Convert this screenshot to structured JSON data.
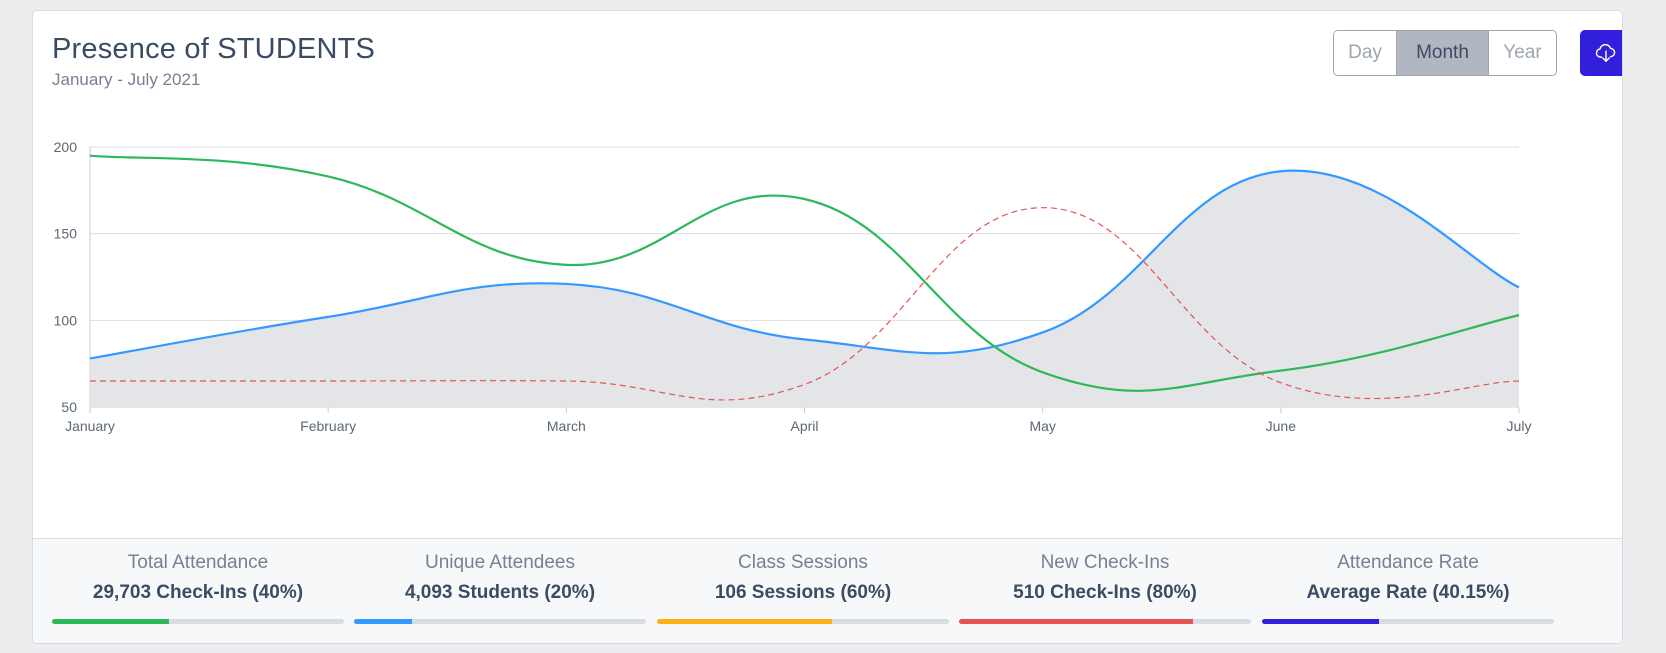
{
  "header": {
    "title": "Presence of STUDENTS",
    "subtitle": "January - July 2021"
  },
  "period_toggle": {
    "options": [
      "Day",
      "Month",
      "Year"
    ],
    "selected": "Month"
  },
  "download_icon": "cloud-download-icon",
  "colors": {
    "primary": "#321fdb",
    "success": "#2eb85c",
    "info": "#39f",
    "warning": "#f9b115",
    "danger": "#e55353",
    "area_fill": "#e4e5e8"
  },
  "chart_data": {
    "type": "line",
    "categories": [
      "January",
      "February",
      "March",
      "April",
      "May",
      "June",
      "July"
    ],
    "ylim": [
      50,
      200
    ],
    "yticks": [
      "50",
      "100",
      "150",
      "200"
    ],
    "grid": true,
    "series": [
      {
        "style": "area",
        "color": "#39f",
        "values": [
          78,
          102,
          121,
          89,
          93,
          186,
          119
        ]
      },
      {
        "style": "line",
        "color": "#2eb85c",
        "values": [
          195,
          183,
          132,
          170,
          70,
          71,
          103
        ]
      },
      {
        "style": "dashed",
        "color": "#e55353",
        "values": [
          65,
          65,
          65,
          63,
          165,
          64,
          65
        ]
      }
    ]
  },
  "stats": [
    {
      "label": "Total Attendance",
      "value": "29,703 Check-Ins (40%)",
      "progress": 40,
      "color": "#2eb85c"
    },
    {
      "label": "Unique Attendees",
      "value": "4,093 Students (20%)",
      "progress": 20,
      "color": "#39f"
    },
    {
      "label": "Class Sessions",
      "value": "106 Sessions (60%)",
      "progress": 60,
      "color": "#f9b115"
    },
    {
      "label": "New Check-Ins",
      "value": "510 Check-Ins (80%)",
      "progress": 80,
      "color": "#e55353"
    },
    {
      "label": "Attendance Rate",
      "value": "Average Rate (40.15%)",
      "progress": 40,
      "color": "#321fdb"
    }
  ]
}
